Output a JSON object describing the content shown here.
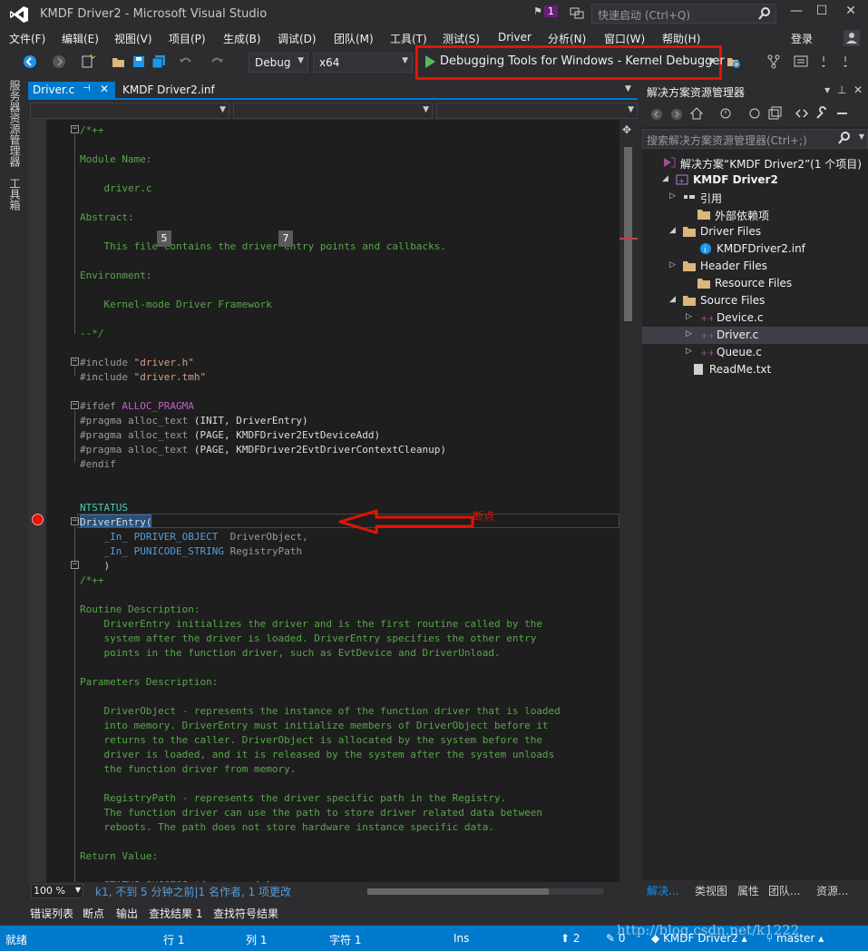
{
  "window": {
    "title": "KMDF Driver2 - Microsoft Visual Studio",
    "notification_count": "1",
    "quick_launch_placeholder": "快速启动 (Ctrl+Q)",
    "minimize": "—",
    "maximize": "☐",
    "close": "✕"
  },
  "menu": {
    "items": [
      "文件(F)",
      "编辑(E)",
      "视图(V)",
      "项目(P)",
      "生成(B)",
      "调试(D)",
      "团队(M)",
      "工具(T)",
      "测试(S)",
      "Driver",
      "分析(N)",
      "窗口(W)",
      "帮助(H)"
    ],
    "login": "登录"
  },
  "toolbar": {
    "configuration": "Debug",
    "platform": "x64",
    "debugger_label": "Debugging Tools for Windows - Kernel Debugger"
  },
  "left_strip": {
    "tabs": [
      "服务器资源管理器",
      "工具箱"
    ]
  },
  "editor": {
    "tabs": [
      {
        "label": "Driver.c",
        "active": true
      },
      {
        "label": "KMDF Driver2.inf",
        "active": false
      }
    ],
    "annotation": "断点",
    "codelens_badges": [
      "5",
      "7"
    ],
    "zoom": "100 %",
    "codelens_status": "k1, 不到 5 分钟之前|1 名作者, 1 项更改",
    "lines": [
      {
        "t": "/*++",
        "c": "cmt"
      },
      {
        "t": "",
        "c": "cmt"
      },
      {
        "t": "Module Name:",
        "c": "cmt"
      },
      {
        "t": "",
        "c": "cmt"
      },
      {
        "t": "    driver.c",
        "c": "cmt"
      },
      {
        "t": "",
        "c": "cmt"
      },
      {
        "t": "Abstract:",
        "c": "cmt"
      },
      {
        "t": "",
        "c": "cmt"
      },
      {
        "t": "    This file contains the driver entry points and callbacks.",
        "c": "cmt"
      },
      {
        "t": "",
        "c": "cmt"
      },
      {
        "t": "Environment:",
        "c": "cmt"
      },
      {
        "t": "",
        "c": "cmt"
      },
      {
        "t": "    Kernel-mode Driver Framework",
        "c": "cmt"
      },
      {
        "t": "",
        "c": "cmt"
      },
      {
        "t": "--*/",
        "c": "cmt"
      },
      {
        "t": "",
        "c": "plain"
      },
      {
        "t": "#include \"driver.h\"",
        "c": "inc"
      },
      {
        "t": "#include \"driver.tmh\"",
        "c": "inc"
      },
      {
        "t": "",
        "c": "plain"
      },
      {
        "t": "#ifdef ALLOC_PRAGMA",
        "c": "ifdef"
      },
      {
        "t": "#pragma alloc_text (INIT, DriverEntry)",
        "c": "pragma"
      },
      {
        "t": "#pragma alloc_text (PAGE, KMDFDriver2EvtDeviceAdd)",
        "c": "pragma"
      },
      {
        "t": "#pragma alloc_text (PAGE, KMDFDriver2EvtDriverContextCleanup)",
        "c": "pragma"
      },
      {
        "t": "#endif",
        "c": "pre"
      },
      {
        "t": "",
        "c": "plain"
      },
      {
        "t": "",
        "c": "plain"
      },
      {
        "t": "NTSTATUS",
        "c": "typ"
      },
      {
        "t": "DriverEntry(",
        "c": "entry"
      },
      {
        "t": "    _In_ PDRIVER_OBJECT  DriverObject,",
        "c": "param"
      },
      {
        "t": "    _In_ PUNICODE_STRING RegistryPath",
        "c": "param"
      },
      {
        "t": "    )",
        "c": "plain"
      },
      {
        "t": "/*++",
        "c": "cmt"
      },
      {
        "t": "",
        "c": "cmt"
      },
      {
        "t": "Routine Description:",
        "c": "cmt"
      },
      {
        "t": "    DriverEntry initializes the driver and is the first routine called by the",
        "c": "cmt"
      },
      {
        "t": "    system after the driver is loaded. DriverEntry specifies the other entry",
        "c": "cmt"
      },
      {
        "t": "    points in the function driver, such as EvtDevice and DriverUnload.",
        "c": "cmt"
      },
      {
        "t": "",
        "c": "cmt"
      },
      {
        "t": "Parameters Description:",
        "c": "cmt"
      },
      {
        "t": "",
        "c": "cmt"
      },
      {
        "t": "    DriverObject - represents the instance of the function driver that is loaded",
        "c": "cmt"
      },
      {
        "t": "    into memory. DriverEntry must initialize members of DriverObject before it",
        "c": "cmt"
      },
      {
        "t": "    returns to the caller. DriverObject is allocated by the system before the",
        "c": "cmt"
      },
      {
        "t": "    driver is loaded, and it is released by the system after the system unloads",
        "c": "cmt"
      },
      {
        "t": "    the function driver from memory.",
        "c": "cmt"
      },
      {
        "t": "",
        "c": "cmt"
      },
      {
        "t": "    RegistryPath - represents the driver specific path in the Registry.",
        "c": "cmt"
      },
      {
        "t": "    The function driver can use the path to store driver related data between",
        "c": "cmt"
      },
      {
        "t": "    reboots. The path does not store hardware instance specific data.",
        "c": "cmt"
      },
      {
        "t": "",
        "c": "cmt"
      },
      {
        "t": "Return Value:",
        "c": "cmt"
      },
      {
        "t": "",
        "c": "cmt"
      },
      {
        "t": "    STATUS_SUCCESS if successful,",
        "c": "cmt"
      }
    ]
  },
  "solution_explorer": {
    "title": "解决方案资源管理器",
    "search_placeholder": "搜索解决方案资源管理器(Ctrl+;)",
    "tree": [
      {
        "label": "解决方案“KMDF Driver2”(1 个项目)",
        "expander": "",
        "bold": false,
        "icon": "solution-icon",
        "selected": false
      },
      {
        "label": "KMDF Driver2",
        "expander": "◢",
        "bold": true,
        "icon": "project-icon",
        "selected": false
      },
      {
        "label": "引用",
        "expander": "▷",
        "bold": false,
        "icon": "references-icon",
        "selected": false
      },
      {
        "label": "外部依赖项",
        "expander": "",
        "bold": false,
        "icon": "folder-icon",
        "selected": false
      },
      {
        "label": "Driver Files",
        "expander": "◢",
        "bold": false,
        "icon": "folder-icon",
        "selected": false
      },
      {
        "label": "KMDFDriver2.inf",
        "expander": "",
        "bold": false,
        "icon": "info-file-icon",
        "selected": false
      },
      {
        "label": "Header Files",
        "expander": "▷",
        "bold": false,
        "icon": "folder-icon",
        "selected": false
      },
      {
        "label": "Resource Files",
        "expander": "",
        "bold": false,
        "icon": "folder-icon",
        "selected": false
      },
      {
        "label": "Source Files",
        "expander": "◢",
        "bold": false,
        "icon": "folder-icon",
        "selected": false
      },
      {
        "label": "Device.c",
        "expander": "▷",
        "bold": false,
        "icon": "c-file-icon",
        "selected": false
      },
      {
        "label": "Driver.c",
        "expander": "▷",
        "bold": false,
        "icon": "c-file-icon",
        "selected": true
      },
      {
        "label": "Queue.c",
        "expander": "▷",
        "bold": false,
        "icon": "c-file-icon",
        "selected": false
      },
      {
        "label": "ReadMe.txt",
        "expander": "",
        "bold": false,
        "icon": "text-file-icon",
        "selected": false
      }
    ],
    "bottom_tabs": [
      "解决...",
      "类视图",
      "属性",
      "团队...",
      "资源..."
    ]
  },
  "bottom_panel": {
    "tabs": [
      "错误列表",
      "断点",
      "输出",
      "查找结果 1",
      "查找符号结果"
    ]
  },
  "statusbar": {
    "ready": "就绪",
    "line": "行 1",
    "col": "列 1",
    "char": "字符 1",
    "ins": "Ins",
    "push_count": "2",
    "pending_changes": "0",
    "project": "KMDF Driver2",
    "branch": "master"
  },
  "watermark": "http://blog.csdn.net/k1222",
  "colors": {
    "accent": "#007acc",
    "breakpoint": "#e51400",
    "comment": "#57a64a"
  }
}
